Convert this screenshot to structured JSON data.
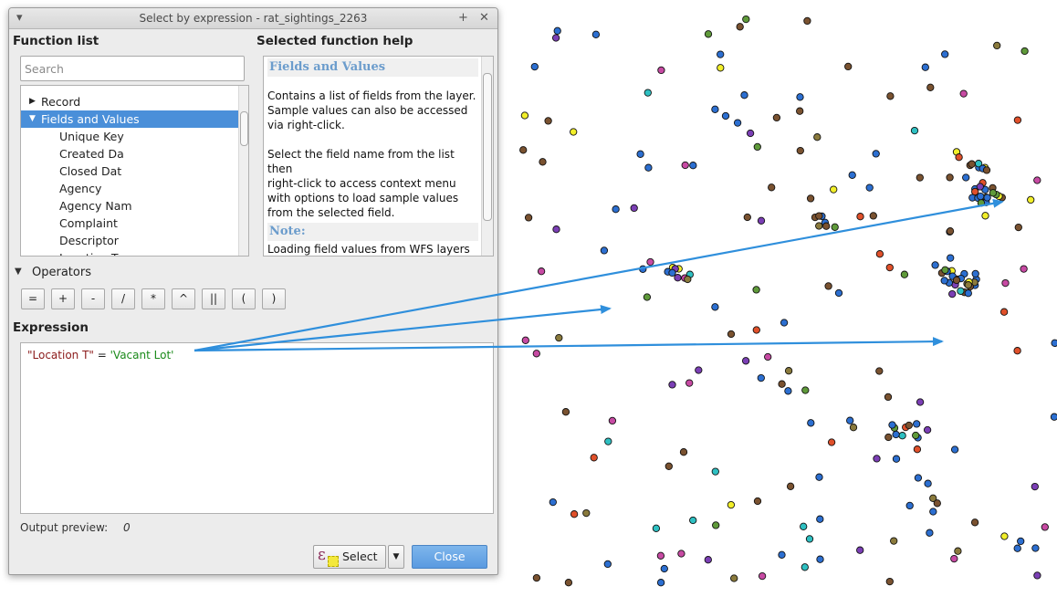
{
  "dialog": {
    "title": "Select by expression - rat_sightings_2263",
    "function_list_label": "Function list",
    "help_label": "Selected function help",
    "search_placeholder": "Search",
    "tree": [
      {
        "label": "Record",
        "level": 0,
        "expanded": false,
        "selected": false
      },
      {
        "label": "Fields and Values",
        "level": 0,
        "expanded": true,
        "selected": true
      },
      {
        "label": "Unique Key",
        "level": 1
      },
      {
        "label": "Created Da",
        "level": 1
      },
      {
        "label": "Closed Dat",
        "level": 1
      },
      {
        "label": "Agency",
        "level": 1
      },
      {
        "label": "Agency Nam",
        "level": 1
      },
      {
        "label": "Complaint",
        "level": 1
      },
      {
        "label": "Descriptor",
        "level": 1
      },
      {
        "label": "Location T",
        "level": 1
      }
    ],
    "help": {
      "heading": "Fields and Values",
      "para1": [
        "Contains a list of fields from the layer.",
        "Sample values can also be accessed",
        "via right-click."
      ],
      "para2": [
        "Select the field name from the list then",
        "right-click to access context menu",
        "with options to load sample values",
        "from the selected field."
      ],
      "note_heading": "Note:",
      "note_text": [
        "Loading field values from WFS layers"
      ]
    },
    "operators_label": "Operators",
    "operators": [
      "=",
      "+",
      "-",
      "/",
      "*",
      "^",
      "||",
      "(",
      ")"
    ],
    "expression_label": "Expression",
    "expression": {
      "field": "\"Location T\"",
      "op": " = ",
      "value": "'Vacant Lot'"
    },
    "output_preview_label": "Output preview:",
    "output_preview_value": "0",
    "select_button": "Select",
    "close_button": "Close"
  },
  "colors": {
    "selection": "#4a8fd9",
    "help_heading": "#6b9ccc",
    "expr_field": "#8b1a1a",
    "expr_string": "#1a8a1a",
    "arrow": "#2f8fdc",
    "point_palette": {
      "blue": "#2c6fd1",
      "brown": "#7a5230",
      "magenta": "#c74aa3",
      "teal": "#2ec0c2",
      "yellow": "#f2ef2a",
      "olive": "#8a7a3c",
      "red": "#e0502a",
      "green": "#5f9a3a",
      "purple": "#7b3fb5"
    }
  }
}
